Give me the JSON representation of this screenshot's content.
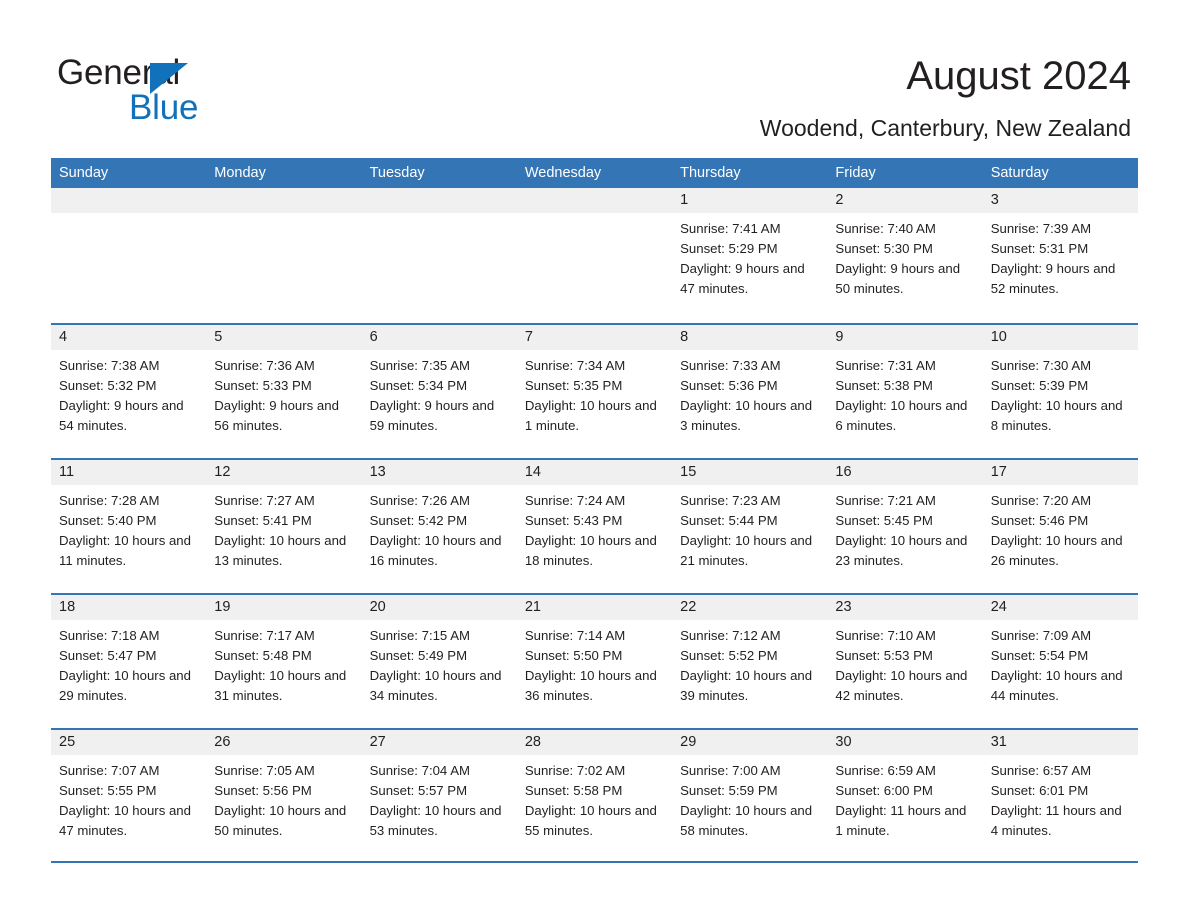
{
  "logo": {
    "word1": "General",
    "word2": "Blue",
    "triangle_icon": "triangle-icon",
    "blue": "#1271bb"
  },
  "header": {
    "title": "August 2024",
    "subtitle": "Woodend, Canterbury, New Zealand"
  },
  "colors": {
    "header_blue": "#3375b5",
    "day_band_gray": "#f0f0f0",
    "text": "#231f20"
  },
  "weekdays": [
    "Sunday",
    "Monday",
    "Tuesday",
    "Wednesday",
    "Thursday",
    "Friday",
    "Saturday"
  ],
  "weeks": [
    [
      {
        "day": "",
        "empty": true
      },
      {
        "day": "",
        "empty": true
      },
      {
        "day": "",
        "empty": true
      },
      {
        "day": "",
        "empty": true
      },
      {
        "day": "1",
        "sunrise": "Sunrise: 7:41 AM",
        "sunset": "Sunset: 5:29 PM",
        "daylight": "Daylight: 9 hours and 47 minutes."
      },
      {
        "day": "2",
        "sunrise": "Sunrise: 7:40 AM",
        "sunset": "Sunset: 5:30 PM",
        "daylight": "Daylight: 9 hours and 50 minutes."
      },
      {
        "day": "3",
        "sunrise": "Sunrise: 7:39 AM",
        "sunset": "Sunset: 5:31 PM",
        "daylight": "Daylight: 9 hours and 52 minutes."
      }
    ],
    [
      {
        "day": "4",
        "sunrise": "Sunrise: 7:38 AM",
        "sunset": "Sunset: 5:32 PM",
        "daylight": "Daylight: 9 hours and 54 minutes."
      },
      {
        "day": "5",
        "sunrise": "Sunrise: 7:36 AM",
        "sunset": "Sunset: 5:33 PM",
        "daylight": "Daylight: 9 hours and 56 minutes."
      },
      {
        "day": "6",
        "sunrise": "Sunrise: 7:35 AM",
        "sunset": "Sunset: 5:34 PM",
        "daylight": "Daylight: 9 hours and 59 minutes."
      },
      {
        "day": "7",
        "sunrise": "Sunrise: 7:34 AM",
        "sunset": "Sunset: 5:35 PM",
        "daylight": "Daylight: 10 hours and 1 minute."
      },
      {
        "day": "8",
        "sunrise": "Sunrise: 7:33 AM",
        "sunset": "Sunset: 5:36 PM",
        "daylight": "Daylight: 10 hours and 3 minutes."
      },
      {
        "day": "9",
        "sunrise": "Sunrise: 7:31 AM",
        "sunset": "Sunset: 5:38 PM",
        "daylight": "Daylight: 10 hours and 6 minutes."
      },
      {
        "day": "10",
        "sunrise": "Sunrise: 7:30 AM",
        "sunset": "Sunset: 5:39 PM",
        "daylight": "Daylight: 10 hours and 8 minutes."
      }
    ],
    [
      {
        "day": "11",
        "sunrise": "Sunrise: 7:28 AM",
        "sunset": "Sunset: 5:40 PM",
        "daylight": "Daylight: 10 hours and 11 minutes."
      },
      {
        "day": "12",
        "sunrise": "Sunrise: 7:27 AM",
        "sunset": "Sunset: 5:41 PM",
        "daylight": "Daylight: 10 hours and 13 minutes."
      },
      {
        "day": "13",
        "sunrise": "Sunrise: 7:26 AM",
        "sunset": "Sunset: 5:42 PM",
        "daylight": "Daylight: 10 hours and 16 minutes."
      },
      {
        "day": "14",
        "sunrise": "Sunrise: 7:24 AM",
        "sunset": "Sunset: 5:43 PM",
        "daylight": "Daylight: 10 hours and 18 minutes."
      },
      {
        "day": "15",
        "sunrise": "Sunrise: 7:23 AM",
        "sunset": "Sunset: 5:44 PM",
        "daylight": "Daylight: 10 hours and 21 minutes."
      },
      {
        "day": "16",
        "sunrise": "Sunrise: 7:21 AM",
        "sunset": "Sunset: 5:45 PM",
        "daylight": "Daylight: 10 hours and 23 minutes."
      },
      {
        "day": "17",
        "sunrise": "Sunrise: 7:20 AM",
        "sunset": "Sunset: 5:46 PM",
        "daylight": "Daylight: 10 hours and 26 minutes."
      }
    ],
    [
      {
        "day": "18",
        "sunrise": "Sunrise: 7:18 AM",
        "sunset": "Sunset: 5:47 PM",
        "daylight": "Daylight: 10 hours and 29 minutes."
      },
      {
        "day": "19",
        "sunrise": "Sunrise: 7:17 AM",
        "sunset": "Sunset: 5:48 PM",
        "daylight": "Daylight: 10 hours and 31 minutes."
      },
      {
        "day": "20",
        "sunrise": "Sunrise: 7:15 AM",
        "sunset": "Sunset: 5:49 PM",
        "daylight": "Daylight: 10 hours and 34 minutes."
      },
      {
        "day": "21",
        "sunrise": "Sunrise: 7:14 AM",
        "sunset": "Sunset: 5:50 PM",
        "daylight": "Daylight: 10 hours and 36 minutes."
      },
      {
        "day": "22",
        "sunrise": "Sunrise: 7:12 AM",
        "sunset": "Sunset: 5:52 PM",
        "daylight": "Daylight: 10 hours and 39 minutes."
      },
      {
        "day": "23",
        "sunrise": "Sunrise: 7:10 AM",
        "sunset": "Sunset: 5:53 PM",
        "daylight": "Daylight: 10 hours and 42 minutes."
      },
      {
        "day": "24",
        "sunrise": "Sunrise: 7:09 AM",
        "sunset": "Sunset: 5:54 PM",
        "daylight": "Daylight: 10 hours and 44 minutes."
      }
    ],
    [
      {
        "day": "25",
        "sunrise": "Sunrise: 7:07 AM",
        "sunset": "Sunset: 5:55 PM",
        "daylight": "Daylight: 10 hours and 47 minutes."
      },
      {
        "day": "26",
        "sunrise": "Sunrise: 7:05 AM",
        "sunset": "Sunset: 5:56 PM",
        "daylight": "Daylight: 10 hours and 50 minutes."
      },
      {
        "day": "27",
        "sunrise": "Sunrise: 7:04 AM",
        "sunset": "Sunset: 5:57 PM",
        "daylight": "Daylight: 10 hours and 53 minutes."
      },
      {
        "day": "28",
        "sunrise": "Sunrise: 7:02 AM",
        "sunset": "Sunset: 5:58 PM",
        "daylight": "Daylight: 10 hours and 55 minutes."
      },
      {
        "day": "29",
        "sunrise": "Sunrise: 7:00 AM",
        "sunset": "Sunset: 5:59 PM",
        "daylight": "Daylight: 10 hours and 58 minutes."
      },
      {
        "day": "30",
        "sunrise": "Sunrise: 6:59 AM",
        "sunset": "Sunset: 6:00 PM",
        "daylight": "Daylight: 11 hours and 1 minute."
      },
      {
        "day": "31",
        "sunrise": "Sunrise: 6:57 AM",
        "sunset": "Sunset: 6:01 PM",
        "daylight": "Daylight: 11 hours and 4 minutes."
      }
    ]
  ]
}
